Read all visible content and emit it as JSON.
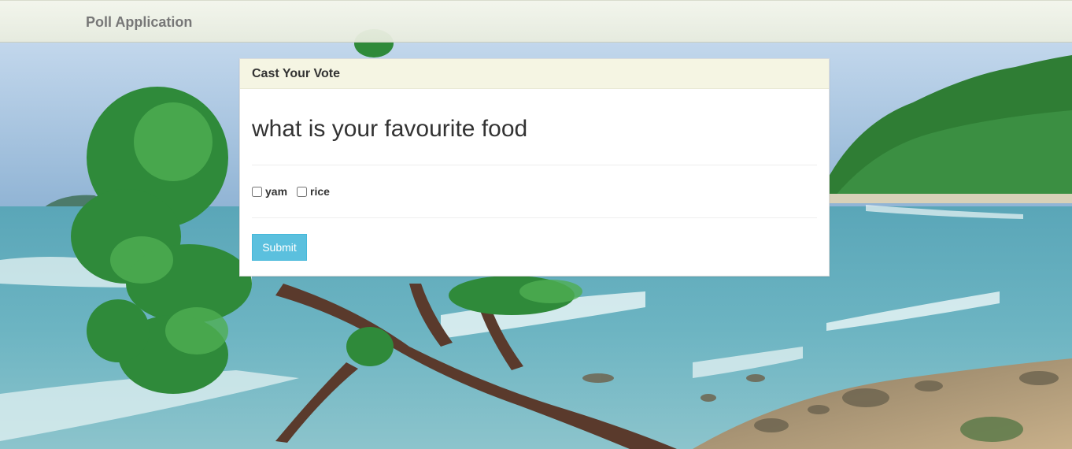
{
  "navbar": {
    "brand": "Poll Application"
  },
  "panel": {
    "heading": "Cast Your Vote",
    "question": "what is your favourite food",
    "options": [
      {
        "label": "yam",
        "checked": false
      },
      {
        "label": "rice",
        "checked": false
      }
    ],
    "submit_label": "Submit"
  },
  "colors": {
    "accent_button": "#5bc0de",
    "panel_heading_bg": "#f5f5e3",
    "brand_text": "#777777"
  }
}
